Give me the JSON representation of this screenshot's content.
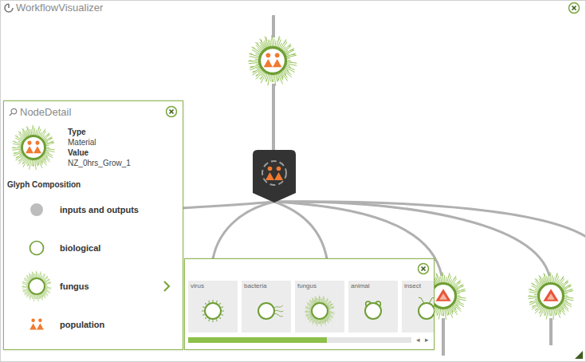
{
  "window": {
    "title": "WorkflowVisualizer"
  },
  "canvas": {
    "nodes": [
      {
        "kind": "material"
      },
      {
        "kind": "process"
      },
      {
        "kind": "sample"
      },
      {
        "kind": "sample"
      }
    ]
  },
  "node_detail": {
    "title": "NodeDetail",
    "type_label": "Type",
    "type_value": "Material",
    "value_label": "Value",
    "value": "NZ_0hrs_Grow_1",
    "section": "Glyph Composition",
    "components": [
      {
        "kind": "io",
        "label": "inputs and outputs",
        "expandable": false
      },
      {
        "kind": "biological",
        "label": "biological",
        "expandable": false
      },
      {
        "kind": "fungus",
        "label": "fungus",
        "expandable": true
      },
      {
        "kind": "population",
        "label": "population",
        "expandable": false
      }
    ]
  },
  "glyph_picker": {
    "options": [
      {
        "kind": "virus",
        "label": "virus"
      },
      {
        "kind": "bacteria",
        "label": "bacteria"
      },
      {
        "kind": "fungus",
        "label": "fungus"
      },
      {
        "kind": "animal",
        "label": "animal"
      },
      {
        "kind": "insect",
        "label": "insect"
      }
    ],
    "scroll": {
      "level": 0.62,
      "prev": "◂",
      "next": "▸"
    }
  }
}
